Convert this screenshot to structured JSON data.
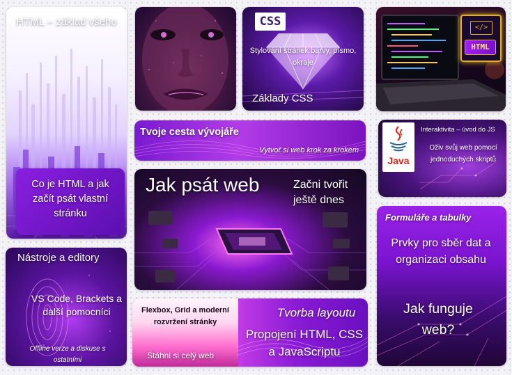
{
  "tiles": {
    "html_basics": {
      "title": "HTML – základ všeho",
      "card": "Co je HTML a jak začít psát vlastní stránku"
    },
    "css": {
      "badge": "CSS",
      "subtitle": "Stylování stránek barvy, písmo, okraje",
      "title": "Základy CSS"
    },
    "html_file": {
      "badge": "HTML"
    },
    "path": {
      "title": "Tvoje cesta vývojáře",
      "subtitle": "Vytvoř si web krok za krokem"
    },
    "js": {
      "logo_text": "Java",
      "title": "Interaktivita – úvod do JS",
      "subtitle": "Oživ svůj web pomocí jednoduchých skriptů"
    },
    "write_web": {
      "title": "Jak psát web",
      "cta": "Začni tvořit ještě dnes"
    },
    "forms": {
      "title": "Formuláře a tabulky",
      "subtitle": "Prvky pro sběr dat a organizaci obsahu",
      "question": "Jak funguje web?"
    },
    "tools": {
      "title": "Nástroje a editory",
      "subtitle": "VS Code, Brackets a další pomocníci",
      "note": "Offline verze a diskuse s ostatními"
    },
    "layout": {
      "left_title": "Flexbox, Grid a moderní rozvržení stránky",
      "left_cta": "Stáhni si celý web",
      "title": "Tvorba layoutu",
      "subtitle": "Propojení HTML, CSS a JavaScriptu"
    }
  },
  "colors": {
    "accent_purple": "#a238ff",
    "magenta": "#e03dd6",
    "deep": "#1c0635",
    "java_red": "#e2231a"
  }
}
